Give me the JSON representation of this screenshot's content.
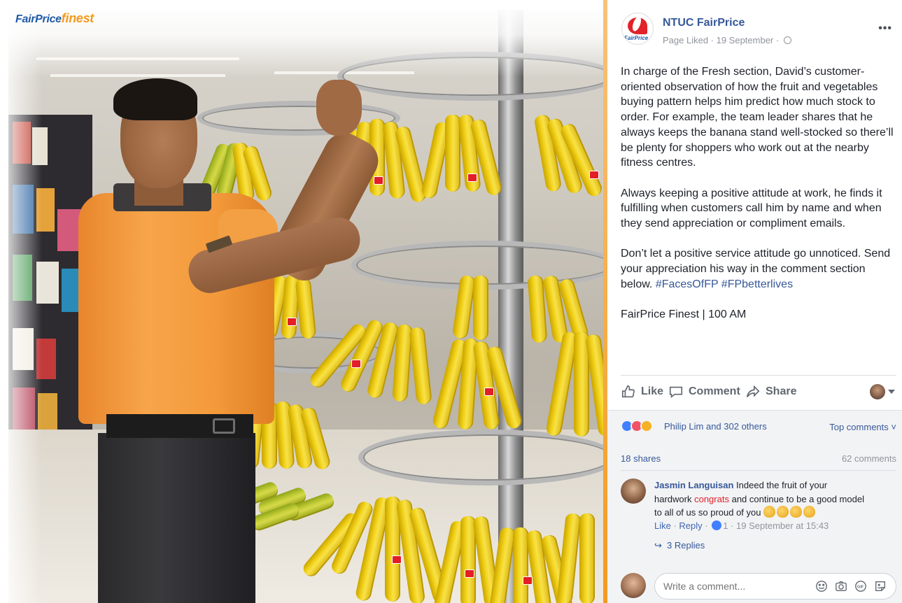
{
  "photo": {
    "brand_logo_part1": "FairPrice",
    "brand_logo_part2": "finest"
  },
  "post": {
    "page_name": "NTUC FairPrice",
    "avatar_caption": "FairPrice",
    "meta": "Page Liked · 19 September ·",
    "paragraphs": [
      "In charge of the Fresh section, David’s customer-oriented observation of how the fruit and vegetables buying pattern helps him predict how much stock to order. For example, the team leader shares that he always keeps the banana stand well-stocked so there’ll be plenty for shoppers who work out at the nearby fitness centres.",
      "Always keeping a positive attitude at work, he finds it fulfilling when customers call him by name and when they send appreciation or compliment emails."
    ],
    "paragraph3_text": "Don’t let a positive service attitude go unnoticed. Send your appreciation his way in the comment section below.",
    "hashtags": [
      "#FacesOfFP",
      "#FPbetterlives"
    ],
    "location_line": "FairPrice Finest | 100 AM"
  },
  "actions": {
    "like": "Like",
    "comment": "Comment",
    "share": "Share"
  },
  "engagement": {
    "reactions_text": "Philip Lim and 302 others",
    "sort_label": "Top comments",
    "shares": "18 shares",
    "comments_count": "62 comments"
  },
  "comment": {
    "author": "Jasmin Languisan",
    "text_before": "Indeed the fruit of your hardwork",
    "highlight": "congrats",
    "text_after": "and continue to be a good model to all of us so proud of you",
    "like_label": "Like",
    "reply_label": "Reply",
    "like_count": "1",
    "timestamp": "19 September at 15:43",
    "replies_label": "3 Replies"
  },
  "composer": {
    "placeholder": "Write a comment..."
  },
  "colors": {
    "link_blue": "#365899",
    "brand_red": "#e2212a",
    "brand_orange": "#f39a1e"
  }
}
